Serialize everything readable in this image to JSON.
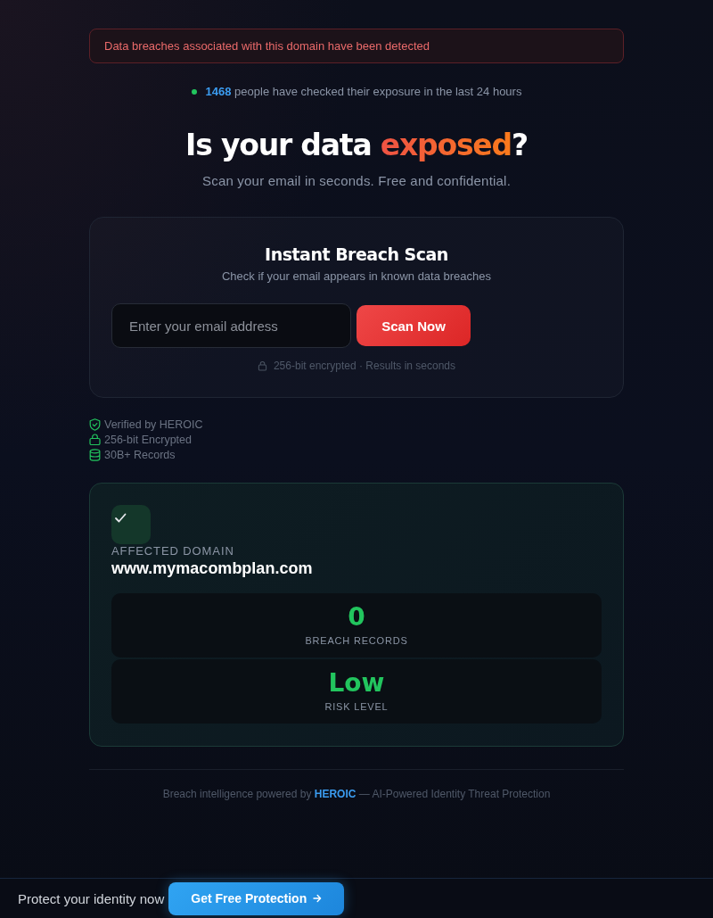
{
  "alert": {
    "text": "Data breaches associated with this domain have been detected"
  },
  "activity": {
    "count": "1468",
    "text": "people have checked their exposure in the last 24 hours"
  },
  "hero": {
    "title_start": "Is your data ",
    "title_highlight": "exposed",
    "title_end": "?",
    "subtitle": "Scan your email in seconds. Free and confidential."
  },
  "scan_card": {
    "title": "Instant Breach Scan",
    "subtitle": "Check if your email appears in known data breaches",
    "email_field": {
      "placeholder": "Enter your email address"
    },
    "button": "Scan Now",
    "note": "256-bit encrypted · Results in seconds"
  },
  "trust_badges": [
    {
      "kind": "shield",
      "label": "Verified by HEROIC"
    },
    {
      "kind": "lock",
      "label": "256-bit Encrypted"
    },
    {
      "kind": "database",
      "label": "30B+ Records"
    }
  ],
  "result": {
    "label": "AFFECTED DOMAIN",
    "domain": "www.mymacombplan.com",
    "stats": [
      {
        "value": "0",
        "label": "BREACH RECORDS"
      },
      {
        "value": "Low",
        "label": "RISK LEVEL"
      }
    ]
  },
  "footer": {
    "text_start": "Breach intelligence powered by ",
    "brand": "HEROIC",
    "text_end": " — AI-Powered Identity Threat Protection"
  },
  "bottom_bar": {
    "text": "Protect your identity now",
    "button": "Get Free Protection"
  }
}
